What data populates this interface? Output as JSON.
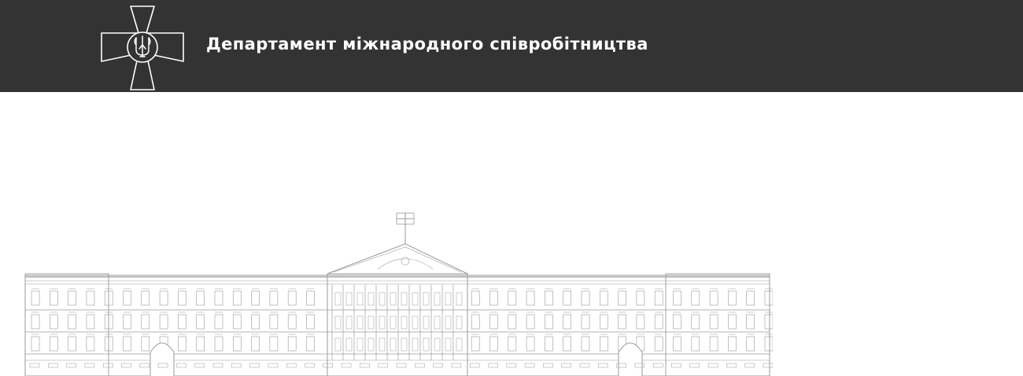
{
  "header": {
    "title": "Департамент міжнародного співробітництва",
    "emblem_icon": "military-cross-trident-icon",
    "background_color": "#333333"
  },
  "hero": {
    "image_icon": "government-building-facade-illustration"
  }
}
